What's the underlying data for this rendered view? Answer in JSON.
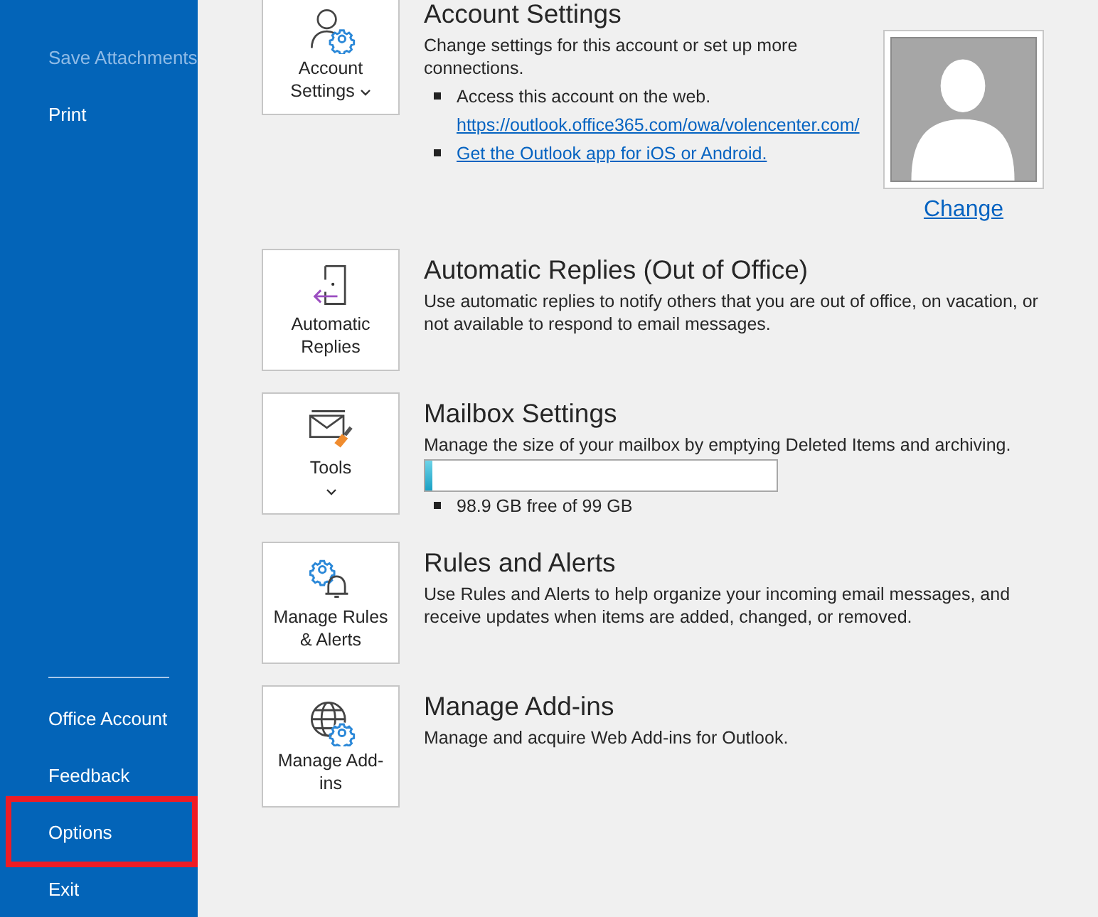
{
  "sidebar": {
    "items": [
      {
        "label": "Save Attachments",
        "disabled": true,
        "highlighted": false
      },
      {
        "label": "Print",
        "disabled": false,
        "highlighted": false
      }
    ],
    "bottom_items": [
      {
        "label": "Office Account",
        "disabled": false,
        "highlighted": false
      },
      {
        "label": "Feedback",
        "disabled": false,
        "highlighted": false
      },
      {
        "label": "Options",
        "disabled": false,
        "highlighted": true
      },
      {
        "label": "Exit",
        "disabled": false,
        "highlighted": false
      }
    ]
  },
  "sections": [
    {
      "kind": "account",
      "tile": "Account Settings",
      "dropdown": true,
      "title": "Account Settings",
      "description": "Change settings for this account or set up more connections.",
      "bullets": [
        {
          "text": "Access this account on the web.",
          "link": "https://outlook.office365.com/owa/volencenter.com/"
        },
        {
          "link": "Get the Outlook app for iOS or Android."
        }
      ],
      "photo": {
        "change_link": "Change"
      }
    },
    {
      "kind": "auto_replies",
      "tile": "Automatic Replies",
      "dropdown": false,
      "title": "Automatic Replies (Out of Office)",
      "description": "Use automatic replies to notify others that you are out of office, on vacation, or not available to respond to email messages."
    },
    {
      "kind": "tools",
      "tile": "Tools",
      "dropdown": true,
      "title": "Mailbox Settings",
      "description": "Manage the size of your mailbox by emptying Deleted Items and archiving.",
      "storage": {
        "level": 0.02,
        "reading": "98.9 GB free of 99 GB"
      }
    },
    {
      "kind": "rules",
      "tile": "Manage Rules & Alerts",
      "dropdown": false,
      "title": "Rules and Alerts",
      "description": "Use Rules and Alerts to help organize your incoming email messages, and receive updates when items are added, changed, or removed."
    },
    {
      "kind": "addins",
      "tile": "Manage Add-ins",
      "dropdown": false,
      "title": "Manage Add-ins",
      "description": "Manage and acquire Web Add-ins for Outlook."
    }
  ]
}
